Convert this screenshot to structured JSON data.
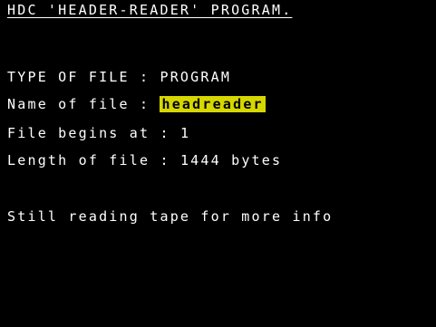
{
  "screen": {
    "title": "HDC 'HEADER-READER' PROGRAM.",
    "type_label": "TYPE OF FILE : ",
    "type_value": "PROGRAM",
    "name_label": "Name of file : ",
    "name_value": "headreader",
    "begins_label": "File begins at : ",
    "begins_value": "1",
    "length_label": "Length of file : ",
    "length_value": "1444 bytes",
    "status": "Still reading tape for more info"
  },
  "colors": {
    "background": "#000000",
    "text": "#ffffff",
    "highlight": "#d7d700"
  }
}
